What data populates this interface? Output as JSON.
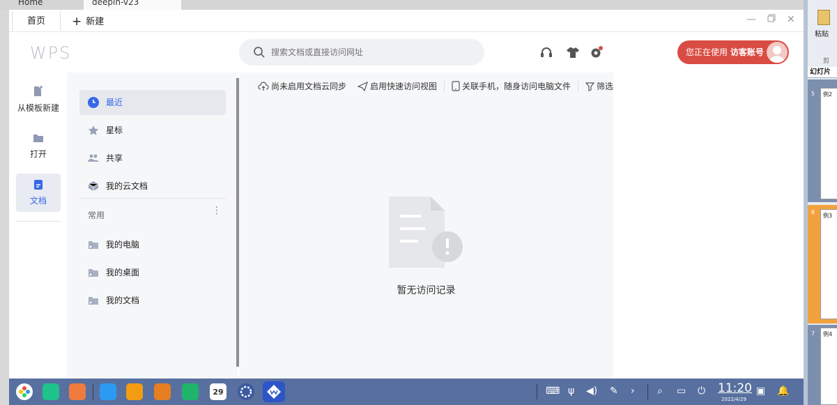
{
  "outer_tabs": [
    "Home",
    "deepin-v23"
  ],
  "tabs": {
    "home": "首页",
    "new_plus": "+",
    "new": "新建"
  },
  "header": {
    "logo": "WPS",
    "search_placeholder": "搜索文档或直接访问网址",
    "account_prefix": "您正在使用",
    "account_name": "访客账号"
  },
  "leftnav": [
    {
      "label": "从模板新建",
      "icon": "template-icon"
    },
    {
      "label": "打开",
      "icon": "folder-icon"
    },
    {
      "label": "文档",
      "icon": "document-icon",
      "active": true
    }
  ],
  "sidebar": {
    "items": [
      "最近",
      "星标",
      "共享",
      "我的云文档"
    ],
    "common_label": "常用",
    "more": "⋮",
    "locations": [
      "我的电脑",
      "我的桌面",
      "我的文档"
    ]
  },
  "toolbar": {
    "cloud_sync": "尚未启用文档云同步",
    "quick_view": "启用快速访问视图",
    "phone": "关联手机，随身访问电脑文件",
    "filter": "筛选"
  },
  "empty": {
    "text": "暂无访问记录"
  },
  "taskbar": {
    "calendar_day": "29",
    "time": "11:20",
    "date": "2022/4/29"
  },
  "ppt": {
    "paste": "粘贴",
    "cut": "剪",
    "tab": "幻灯片",
    "slides": [
      {
        "num": "5",
        "title": "例2"
      },
      {
        "num": "6",
        "title": "例3"
      },
      {
        "num": "7",
        "title": "例4"
      }
    ]
  },
  "colors": {
    "accent": "#3868e8",
    "account": "#d94c43",
    "taskbar": "#58709f"
  }
}
